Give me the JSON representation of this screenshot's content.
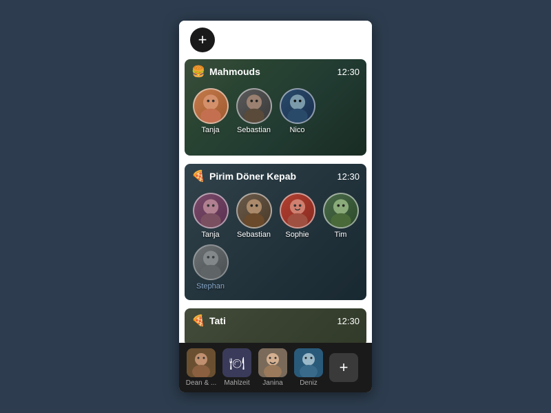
{
  "app": {
    "add_button_label": "+",
    "cards": [
      {
        "id": "mahmouds",
        "icon": "🍔",
        "title": "Mahmouds",
        "time": "12:30",
        "members": [
          {
            "name": "Tanja",
            "face_class": "face-tanja-1",
            "pending": false
          },
          {
            "name": "Sebastian",
            "face_class": "face-sebastian-1",
            "pending": false
          },
          {
            "name": "Nico",
            "face_class": "face-nico",
            "pending": false
          }
        ]
      },
      {
        "id": "pirim",
        "icon": "🍕",
        "title": "Pirim Döner Kepab",
        "time": "12:30",
        "members": [
          {
            "name": "Tanja",
            "face_class": "face-tanja-2",
            "pending": false
          },
          {
            "name": "Sebastian",
            "face_class": "face-sebastian-2",
            "pending": false
          },
          {
            "name": "Sophie",
            "face_class": "face-sophie",
            "pending": false
          },
          {
            "name": "Tim",
            "face_class": "face-tim",
            "pending": false
          },
          {
            "name": "Stephan",
            "face_class": "face-stephan",
            "pending": true
          }
        ]
      },
      {
        "id": "tati",
        "icon": "🍕",
        "title": "Tati",
        "time": "12:30",
        "members": []
      }
    ],
    "bottom_nav": [
      {
        "id": "dean",
        "label": "Dean & ...",
        "face_class": "bottom-av-dean"
      },
      {
        "id": "mahlzeit",
        "label": "Mahlzeit",
        "face_class": "bottom-av-mahlzeit"
      },
      {
        "id": "janina",
        "label": "Janina",
        "face_class": "bottom-av-janina"
      },
      {
        "id": "deniz",
        "label": "Deniz",
        "face_class": "bottom-av-deniz"
      }
    ],
    "bottom_add_label": "+"
  }
}
